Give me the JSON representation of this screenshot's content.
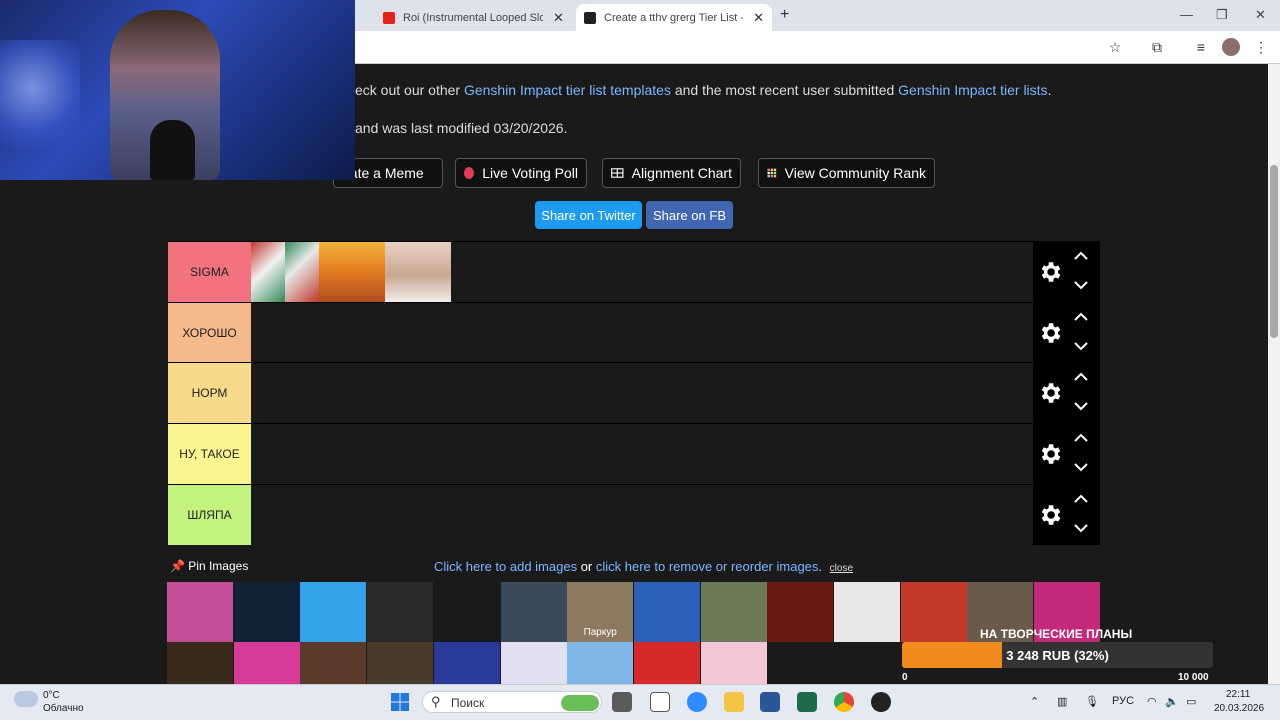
{
  "browser": {
    "tabs": [
      {
        "title": "Roi (Instrumental Looped Slowe",
        "active": false,
        "favicon_color": "#e62117"
      },
      {
        "title": "Create a tthv grerg Tier List - Ti",
        "active": true,
        "favicon_color": "#222222"
      }
    ],
    "new_tab_label": "+",
    "close_glyph": "✕"
  },
  "page": {
    "line1_pre": "eck out our other ",
    "line1_link1": "Genshin Impact tier list templates",
    "line1_mid": " and the most recent user submitted ",
    "line1_link2": "Genshin Impact tier lists",
    "line1_post": ".",
    "line2": "and was last modified 03/20/2026.",
    "buttons": {
      "meme": "eate a Meme",
      "poll": "Live Voting Poll",
      "alignment": "Alignment Chart",
      "community": "View Community Rank"
    },
    "share": {
      "twitter": "Share on Twitter",
      "fb": "Share on FB"
    },
    "tiers": [
      {
        "label": "SIGMA",
        "color": "#f3727f"
      },
      {
        "label": "ХОРОШО",
        "color": "#f5b98a"
      },
      {
        "label": "НОРМ",
        "color": "#f7da8a"
      },
      {
        "label": "НУ, ТАКОЕ",
        "color": "#f9f68f"
      },
      {
        "label": "ШЛЯПА",
        "color": "#c4f27e"
      }
    ],
    "pin_images": "Pin Images",
    "add_images": "Click here to add images",
    "or_text": " or ",
    "reorder": "click here to remove or reorder images",
    "period": ".",
    "close": "close",
    "pool_caption_parkour": "Паркур"
  },
  "donation": {
    "title": "НА ТВОРЧЕСКИЕ ПЛАНЫ",
    "amount": "3 248 RUB (32%)",
    "progress": 0.32,
    "min": "0",
    "max": "10 000"
  },
  "taskbar": {
    "weather_temp": "0°C",
    "weather_desc": "Облачно",
    "search": "Поиск",
    "lang": "РУС",
    "time": "22:11",
    "date": "20.03.2026"
  }
}
